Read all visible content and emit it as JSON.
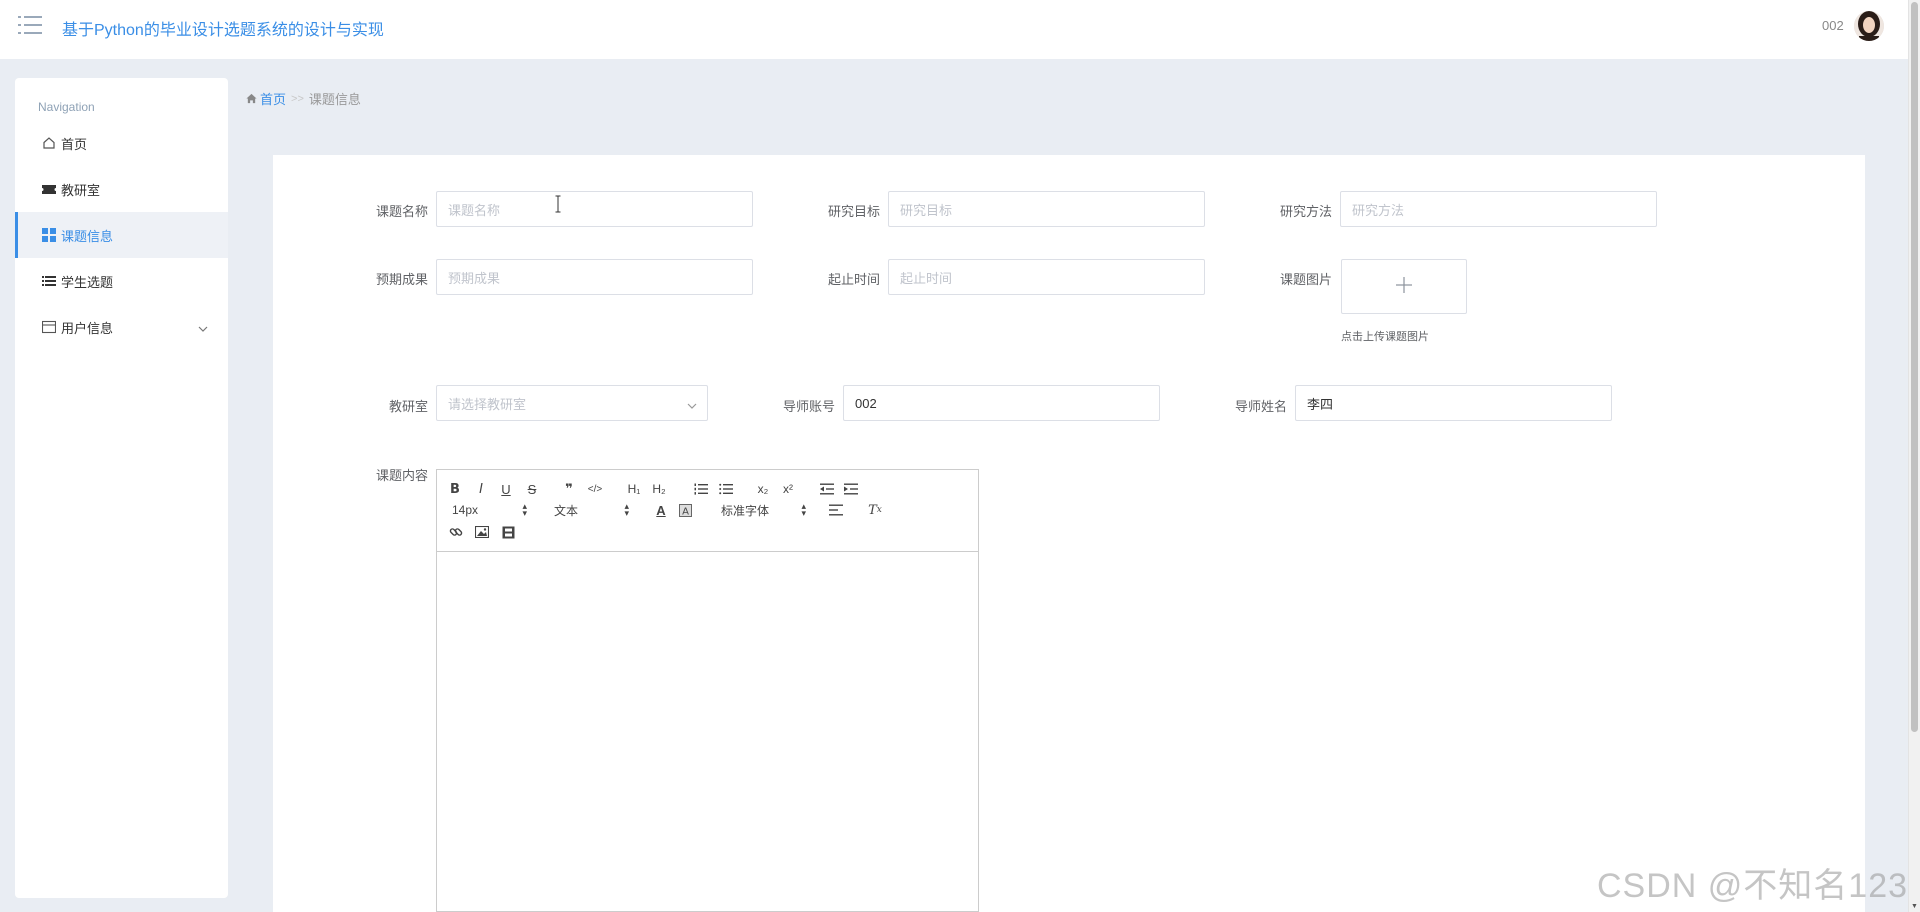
{
  "header": {
    "app_title": "基于Python的毕业设计选题系统的设计与实现",
    "user_name": "002",
    "menu_icon": "menu-list-icon"
  },
  "sidebar": {
    "heading": "Navigation",
    "items": [
      {
        "label": "首页",
        "icon": "home-icon"
      },
      {
        "label": "教研室",
        "icon": "ticket-icon"
      },
      {
        "label": "课题信息",
        "icon": "grid-icon",
        "active": true
      },
      {
        "label": "学生选题",
        "icon": "list-icon"
      },
      {
        "label": "用户信息",
        "icon": "card-icon",
        "expandable": true
      }
    ]
  },
  "breadcrumb": {
    "home": "首页",
    "separator": ">>",
    "current": "课题信息"
  },
  "form": {
    "topic_name": {
      "label": "课题名称",
      "placeholder": "课题名称",
      "value": ""
    },
    "research_goal": {
      "label": "研究目标",
      "placeholder": "研究目标",
      "value": ""
    },
    "research_method": {
      "label": "研究方法",
      "placeholder": "研究方法",
      "value": ""
    },
    "expected_result": {
      "label": "预期成果",
      "placeholder": "预期成果",
      "value": ""
    },
    "period": {
      "label": "起止时间",
      "placeholder": "起止时间",
      "value": ""
    },
    "topic_image": {
      "label": "课题图片",
      "hint": "点击上传课题图片"
    },
    "office": {
      "label": "教研室",
      "placeholder": "请选择教研室",
      "value": ""
    },
    "tutor_account": {
      "label": "导师账号",
      "value": "002"
    },
    "tutor_name": {
      "label": "导师姓名",
      "value": "李四"
    },
    "content": {
      "label": "课题内容"
    }
  },
  "editor": {
    "font_size": "14px",
    "header_select": "文本",
    "font_family": "标准字体",
    "buttons": [
      "bold",
      "italic",
      "underline",
      "strike",
      "blockquote",
      "code-block",
      "h1",
      "h2",
      "ordered-list",
      "bullet-list",
      "subscript",
      "superscript",
      "outdent",
      "indent",
      "color",
      "background",
      "align",
      "clean",
      "link",
      "image",
      "video"
    ]
  },
  "watermark": "CSDN @不知名123",
  "colors": {
    "accent": "#3a8ee6",
    "background": "#e9edf3",
    "border": "#dcdfe6"
  }
}
